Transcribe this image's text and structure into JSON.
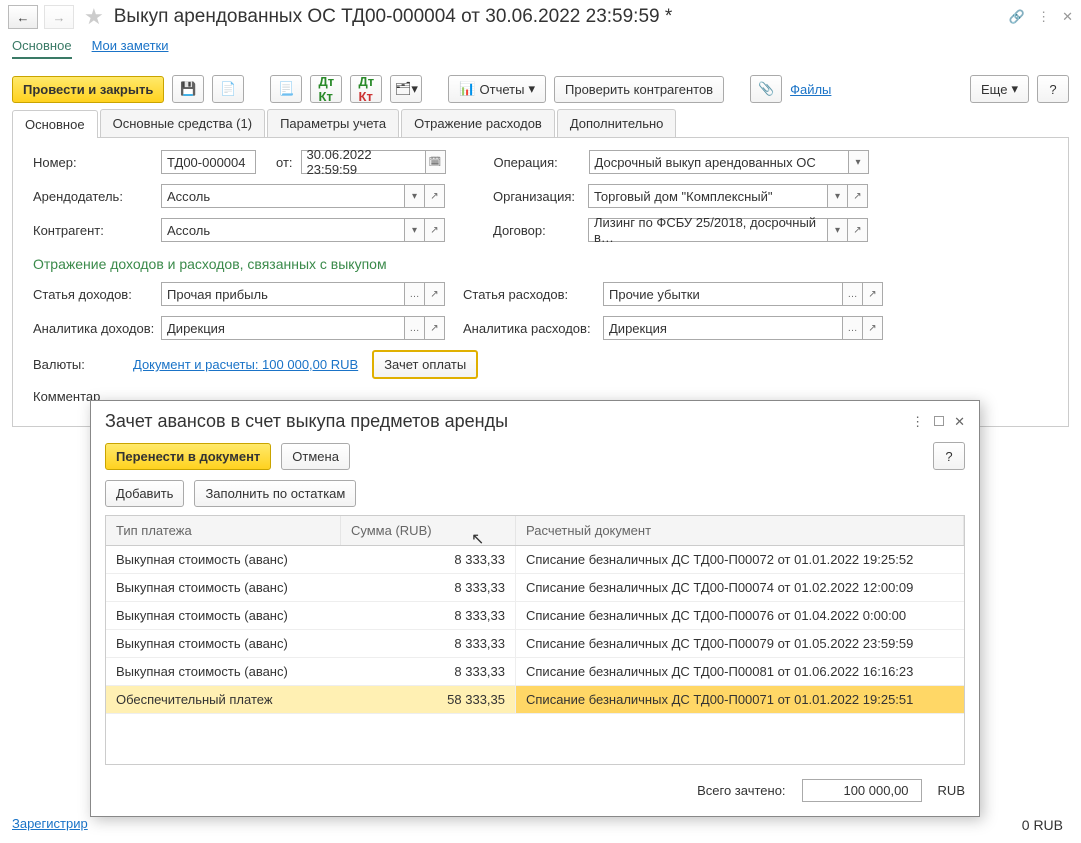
{
  "window": {
    "title": "Выкуп арендованных ОС ТД00-000004 от 30.06.2022 23:59:59 *"
  },
  "linkbar": {
    "main": "Основное",
    "notes": "Мои заметки"
  },
  "toolbar": {
    "post_close": "Провести и закрыть",
    "reports": "Отчеты",
    "check": "Проверить контрагентов",
    "files": "Файлы",
    "more": "Еще"
  },
  "tabs": [
    "Основное",
    "Основные средства (1)",
    "Параметры учета",
    "Отражение расходов",
    "Дополнительно"
  ],
  "form": {
    "number_lbl": "Номер:",
    "number": "ТД00-000004",
    "from_lbl": "от:",
    "date": "30.06.2022 23:59:59",
    "op_lbl": "Операция:",
    "op": "Досрочный выкуп арендованных ОС",
    "lessor_lbl": "Арендодатель:",
    "lessor": "Ассоль",
    "org_lbl": "Организация:",
    "org": "Торговый дом \"Комплексный\"",
    "cpty_lbl": "Контрагент:",
    "cpty": "Ассоль",
    "contract_lbl": "Договор:",
    "contract": "Лизинг по ФСБУ 25/2018,  досрочный в…",
    "sect": "Отражение доходов и расходов, связанных с выкупом",
    "inc_item_lbl": "Статья доходов:",
    "inc_item": "Прочая прибыль",
    "exp_item_lbl": "Статья расходов:",
    "exp_item": "Прочие убытки",
    "inc_an_lbl": "Аналитика доходов:",
    "inc_an": "Дирекция",
    "exp_an_lbl": "Аналитика расходов:",
    "exp_an": "Дирекция",
    "cur_lbl": "Валюты:",
    "cur_link": "Документ и расчеты: 100 000,00 RUB",
    "offset_btn": "Зачет оплаты",
    "comment_lbl": "Комментар"
  },
  "dialog": {
    "title": "Зачет авансов в счет выкупа предметов аренды",
    "move": "Перенести в документ",
    "cancel": "Отмена",
    "add": "Добавить",
    "fill": "Заполнить по остаткам",
    "cols": [
      "Тип платежа",
      "Сумма (RUB)",
      "Расчетный документ"
    ],
    "rows": [
      {
        "t": "Выкупная стоимость (аванс)",
        "s": "8 333,33",
        "d": "Списание безналичных ДС ТД00-П00072 от 01.01.2022 19:25:52"
      },
      {
        "t": "Выкупная стоимость (аванс)",
        "s": "8 333,33",
        "d": "Списание безналичных ДС ТД00-П00074 от 01.02.2022 12:00:09"
      },
      {
        "t": "Выкупная стоимость (аванс)",
        "s": "8 333,33",
        "d": "Списание безналичных ДС ТД00-П00076 от 01.04.2022 0:00:00"
      },
      {
        "t": "Выкупная стоимость (аванс)",
        "s": "8 333,33",
        "d": "Списание безналичных ДС ТД00-П00079 от 01.05.2022 23:59:59"
      },
      {
        "t": "Выкупная стоимость (аванс)",
        "s": "8 333,33",
        "d": "Списание безналичных ДС ТД00-П00081 от 01.06.2022 16:16:23"
      },
      {
        "t": "Обеспечительный платеж",
        "s": "58 333,35",
        "d": "Списание безналичных ДС ТД00-П00071 от 01.01.2022 19:25:51",
        "sel": true
      }
    ],
    "total_lbl": "Всего зачтено:",
    "total": "100 000,00",
    "rub": "RUB"
  },
  "footer": {
    "reg": "Зарегистрир",
    "rub_tail": "0   RUB"
  }
}
